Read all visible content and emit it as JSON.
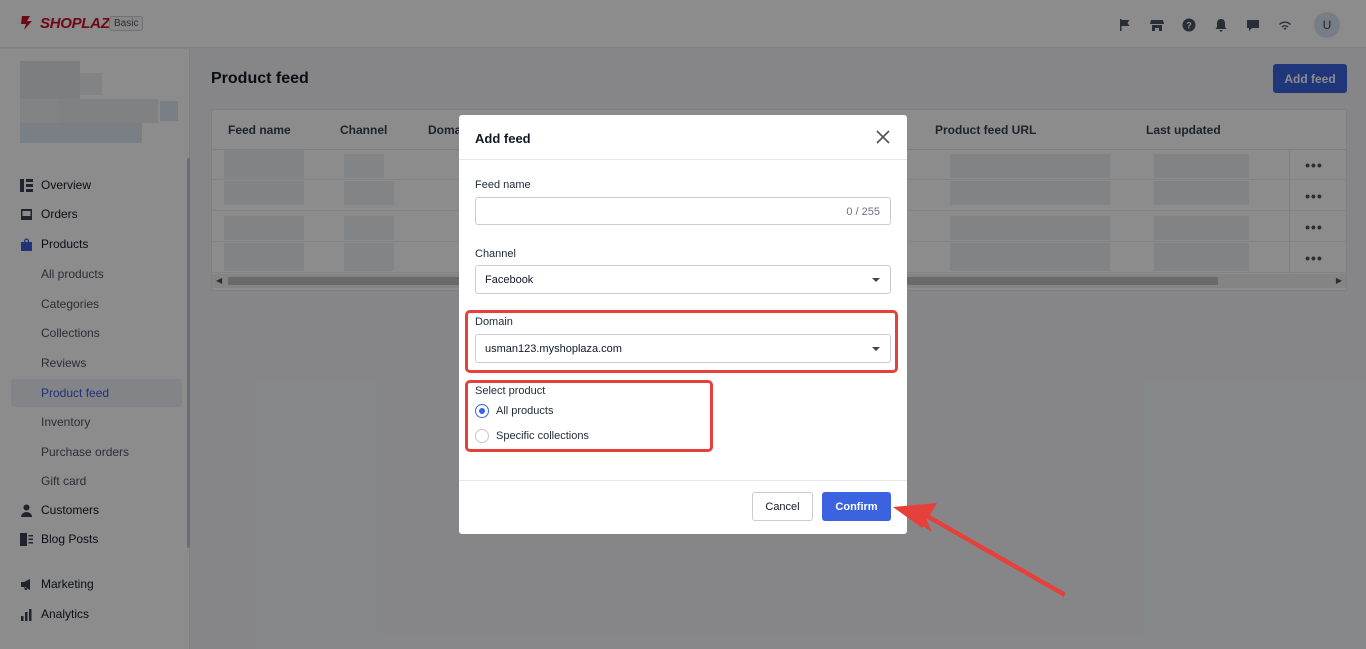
{
  "brand": {
    "name": "SHOPLAZZA",
    "plan": "Basic"
  },
  "topbar": {
    "icons": [
      "flag-icon",
      "store-icon",
      "help-icon",
      "bell-icon",
      "chat-icon",
      "wifi-icon"
    ],
    "avatar_initial": "U"
  },
  "sidebar": {
    "items": [
      {
        "label": "Overview",
        "icon": "overview-icon"
      },
      {
        "label": "Orders",
        "icon": "orders-icon"
      },
      {
        "label": "Products",
        "icon": "products-icon"
      },
      {
        "label": "Customers",
        "icon": "customers-icon"
      },
      {
        "label": "Blog Posts",
        "icon": "blog-icon"
      },
      {
        "label": "Marketing",
        "icon": "marketing-icon"
      },
      {
        "label": "Analytics",
        "icon": "analytics-icon"
      }
    ],
    "product_sub": [
      "All products",
      "Categories",
      "Collections",
      "Reviews",
      "Product feed",
      "Inventory",
      "Purchase orders",
      "Gift card"
    ],
    "active_sub": "Product feed"
  },
  "page": {
    "title": "Product feed",
    "add_button": "Add feed",
    "table": {
      "columns": [
        "Feed name",
        "Channel",
        "Doma",
        "Product feed URL",
        "Last updated"
      ],
      "row_count": 4,
      "more_label": "•••"
    }
  },
  "modal": {
    "title": "Add feed",
    "feed_name": {
      "label": "Feed name",
      "value": "",
      "counter": "0 / 255"
    },
    "channel": {
      "label": "Channel",
      "value": "Facebook"
    },
    "domain": {
      "label": "Domain",
      "value": "usman123.myshoplaza.com"
    },
    "select_product": {
      "label": "Select product",
      "options": [
        "All products",
        "Specific collections"
      ],
      "selected": "All products"
    },
    "cancel": "Cancel",
    "confirm": "Confirm"
  },
  "colors": {
    "accent": "#3b63e0",
    "highlight": "#e5403a",
    "brand": "#c8102e"
  }
}
